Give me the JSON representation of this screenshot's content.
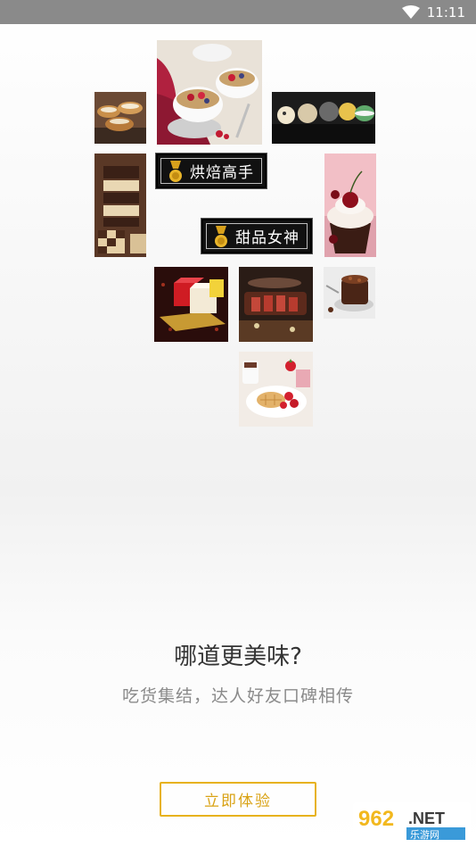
{
  "status_bar": {
    "time": "11:11",
    "icons": [
      "wifi-icon"
    ]
  },
  "badges": {
    "baking": "烘焙高手",
    "dessert": "甜品女神"
  },
  "intro": {
    "title": "哪道更美味?",
    "subtitle": "吃货集结，达人好友口碑相传",
    "cta": "立即体验"
  },
  "watermark": {
    "number": "962",
    "suffix": ".NET",
    "site": "乐游网"
  },
  "colors": {
    "accent": "#e7b21d",
    "status_bar": "#8a8a8a",
    "title": "#333333",
    "subtitle": "#8a8a8a"
  }
}
